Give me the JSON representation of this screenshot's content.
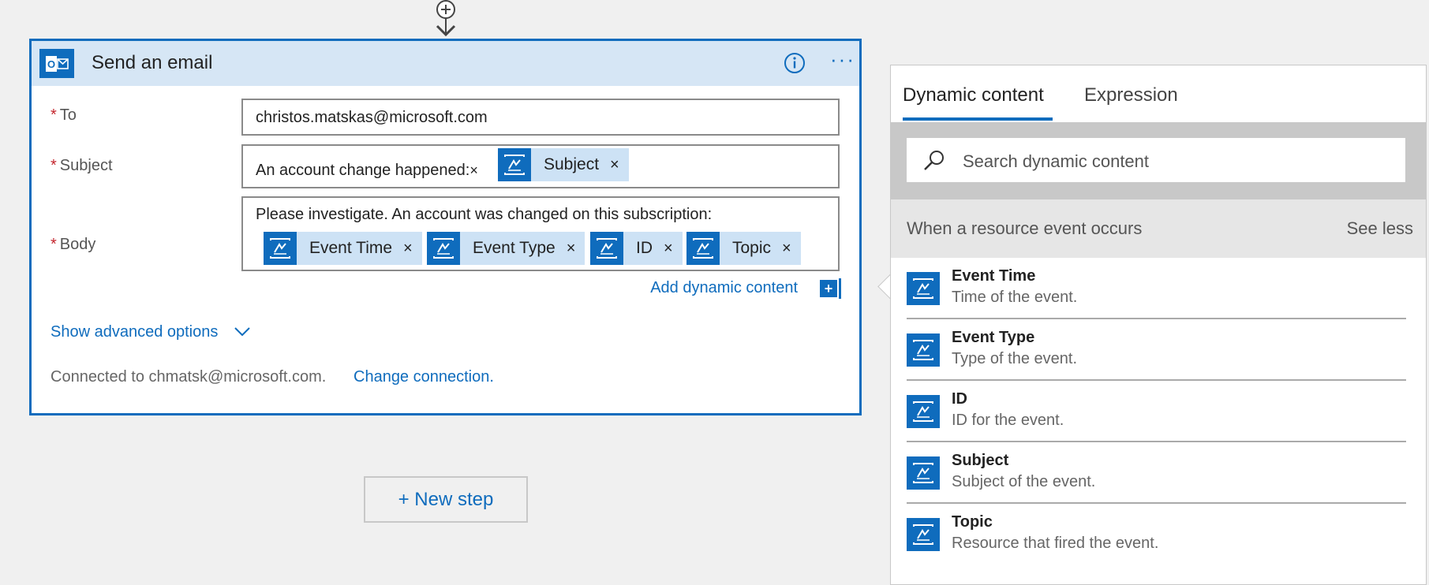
{
  "card": {
    "title": "Send an email",
    "fields": {
      "to": {
        "label": "To",
        "value": "christos.matskas@microsoft.com"
      },
      "subject": {
        "label": "Subject",
        "text": "An account change happened:",
        "text_close": "×",
        "tokens": [
          {
            "label": "Subject",
            "close": "×"
          }
        ]
      },
      "body": {
        "label": "Body",
        "text": "Please investigate. An account was changed on this subscription:",
        "tokens": [
          {
            "label": "Event Time",
            "close": "×"
          },
          {
            "label": "Event Type",
            "close": "×"
          },
          {
            "label": "ID",
            "close": "×"
          },
          {
            "label": "Topic",
            "close": "×"
          }
        ]
      },
      "required_marker": "*"
    },
    "add_dynamic_label": "Add dynamic content",
    "add_dynamic_icon": "+",
    "advanced_options_label": "Show advanced options",
    "connected_text": "Connected to chmatsk@microsoft.com.",
    "change_connection_label": "Change connection.",
    "more_label": "···",
    "outlook_letter": "O"
  },
  "new_step_label": "+ New step",
  "panel": {
    "tabs": [
      {
        "label": "Dynamic content",
        "active": true
      },
      {
        "label": "Expression",
        "active": false
      }
    ],
    "search_placeholder": "Search dynamic content",
    "section_title": "When a resource event occurs",
    "see_less_label": "See less",
    "items": [
      {
        "title": "Event Time",
        "description": "Time of the event."
      },
      {
        "title": "Event Type",
        "description": "Type of the event."
      },
      {
        "title": "ID",
        "description": "ID for the event."
      },
      {
        "title": "Subject",
        "description": "Subject of the event."
      },
      {
        "title": "Topic",
        "description": "Resource that fired the event."
      }
    ]
  },
  "colors": {
    "accent": "#0f6cbd",
    "header_bg": "#d6e6f5",
    "token_bg": "#cde2f5",
    "required": "#c4262e"
  }
}
